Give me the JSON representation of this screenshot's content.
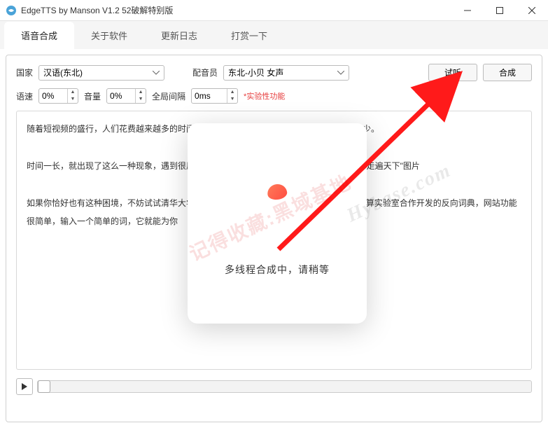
{
  "window": {
    "title": "EdgeTTS by Manson V1.2 52破解特别版"
  },
  "tabs": [
    {
      "label": "语音合成",
      "active": true
    },
    {
      "label": "关于软件",
      "active": false
    },
    {
      "label": "更新日志",
      "active": false
    },
    {
      "label": "打赏一下",
      "active": false
    }
  ],
  "form": {
    "country_label": "国家",
    "country_value": "汉语(东北)",
    "voice_label": "配音员",
    "voice_value": "东北-小贝 女声",
    "preview_btn": "试听",
    "synth_btn": "合成",
    "speed_label": "语速",
    "speed_value": "0%",
    "volume_label": "音量",
    "volume_value": "0%",
    "gap_label": "全局间隔",
    "gap_value": "0ms",
    "experimental": "*实验性功能"
  },
  "text_content": "随着短视频的盛行，人们花费越来越多的时间在观看视频上，而这也导致了阅读时间相对减少。\n\n时间一长，就出现了这么一种现象，遇到很厌                                                          \"一句卧槽走遍天下\"图片\n\n如果你恰好也有这种困境，不妨试试清华大学                                                           会人文计算实验室合作开发的反向词典，网站功能很简单，输入一个简单的词，它就能为你",
  "modal": {
    "message": "多线程合成中，请稍等"
  },
  "watermarks": {
    "wm1": "记得收藏:黑域基地",
    "wm2": "Hybase.com"
  }
}
